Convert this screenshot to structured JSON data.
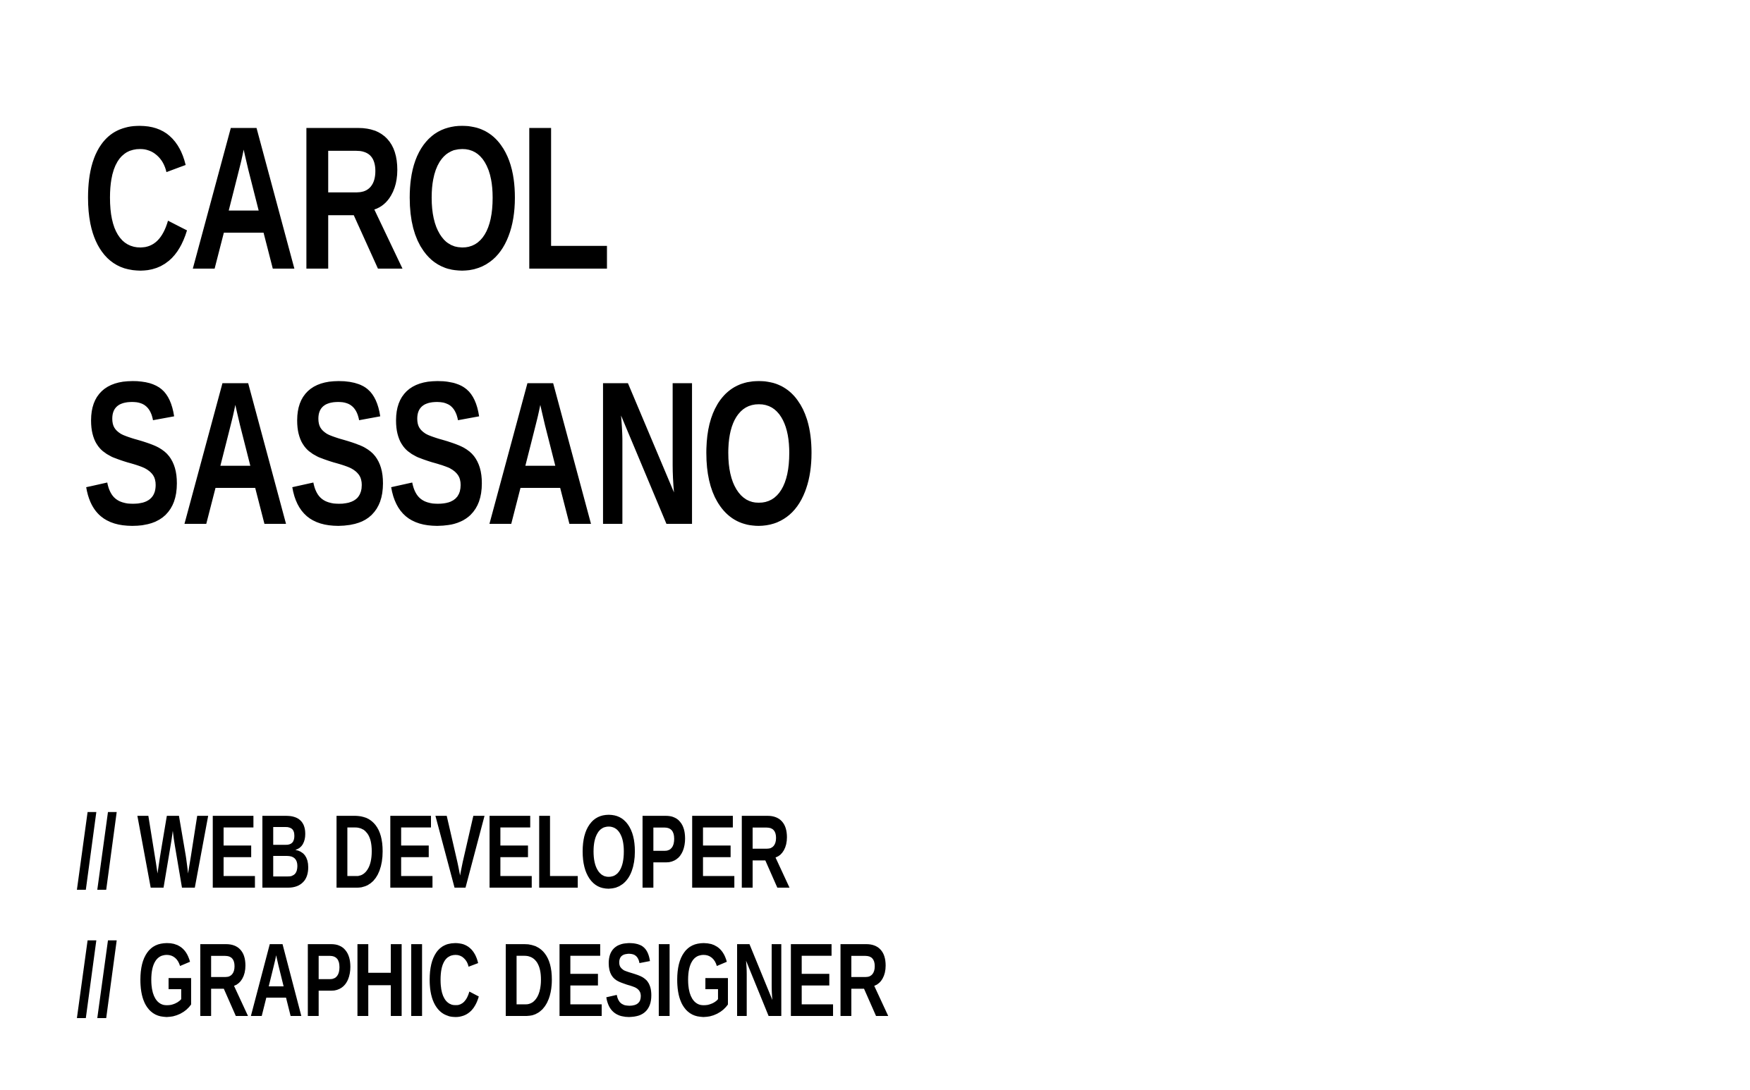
{
  "hero": {
    "first_name": "CAROL",
    "last_name": "SASSANO"
  },
  "roles": [
    {
      "label": "// WEB DEVELOPER"
    },
    {
      "label": "// GRAPHIC DESIGNER"
    }
  ],
  "colors": {
    "background": "#ffffff",
    "text": "#000000"
  }
}
